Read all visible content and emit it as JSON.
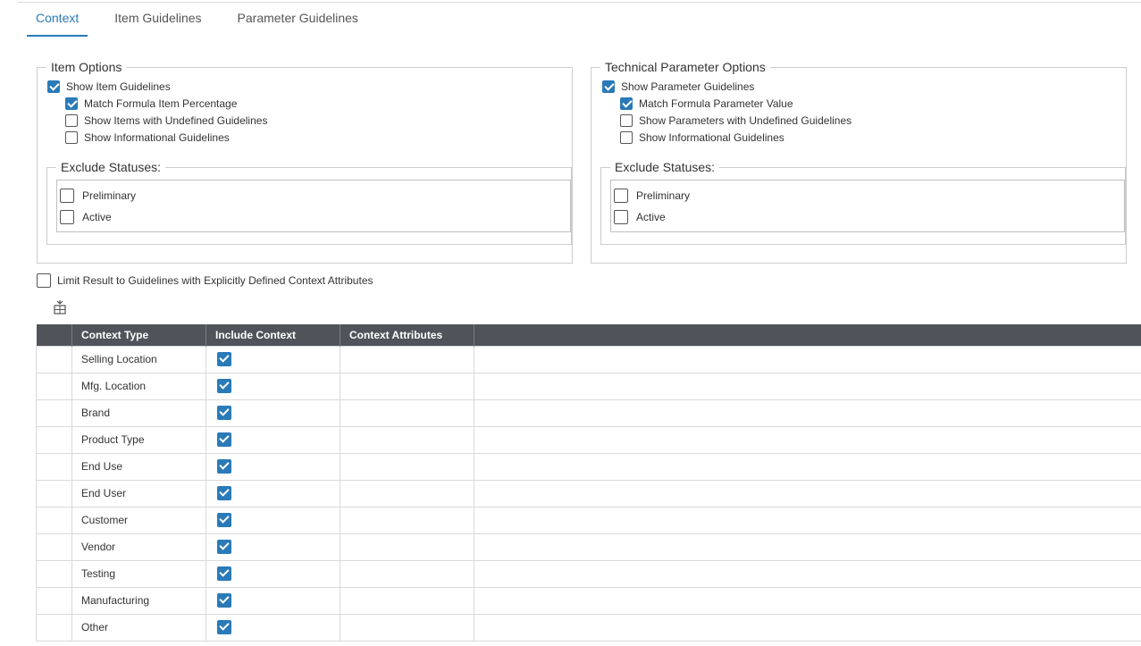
{
  "tabs": [
    "Context",
    "Item Guidelines",
    "Parameter Guidelines"
  ],
  "active_tab": 0,
  "accent_color": "#2a7ab8",
  "item_options": {
    "legend": "Item Options",
    "options": [
      {
        "label": "Show Item Guidelines",
        "checked": true
      },
      {
        "label": "Match Formula Item Percentage",
        "checked": true
      },
      {
        "label": "Show Items with Undefined Guidelines",
        "checked": false
      },
      {
        "label": "Show Informational Guidelines",
        "checked": false
      }
    ],
    "exclude_legend": "Exclude Statuses:",
    "statuses": [
      {
        "label": "Preliminary",
        "checked": false
      },
      {
        "label": "Active",
        "checked": false
      }
    ]
  },
  "param_options": {
    "legend": "Technical Parameter Options",
    "options": [
      {
        "label": "Show Parameter Guidelines",
        "checked": true
      },
      {
        "label": "Match Formula Parameter Value",
        "checked": true
      },
      {
        "label": "Show Parameters with Undefined Guidelines",
        "checked": false
      },
      {
        "label": "Show Informational Guidelines",
        "checked": false
      }
    ],
    "exclude_legend": "Exclude Statuses:",
    "statuses": [
      {
        "label": "Preliminary",
        "checked": false
      },
      {
        "label": "Active",
        "checked": false
      }
    ]
  },
  "limit_label": "Limit Result to Guidelines with Explicitly Defined Context Attributes",
  "limit_checked": false,
  "table": {
    "headers": [
      "",
      "Context Type",
      "Include Context",
      "Context Attributes",
      ""
    ],
    "rows": [
      {
        "type": "Selling Location",
        "include": true,
        "attributes": ""
      },
      {
        "type": "Mfg. Location",
        "include": true,
        "attributes": ""
      },
      {
        "type": "Brand",
        "include": true,
        "attributes": ""
      },
      {
        "type": "Product Type",
        "include": true,
        "attributes": ""
      },
      {
        "type": "End Use",
        "include": true,
        "attributes": ""
      },
      {
        "type": "End User",
        "include": true,
        "attributes": ""
      },
      {
        "type": "Customer",
        "include": true,
        "attributes": ""
      },
      {
        "type": "Vendor",
        "include": true,
        "attributes": ""
      },
      {
        "type": "Testing",
        "include": true,
        "attributes": ""
      },
      {
        "type": "Manufacturing",
        "include": true,
        "attributes": ""
      },
      {
        "type": "Other",
        "include": true,
        "attributes": ""
      }
    ]
  }
}
